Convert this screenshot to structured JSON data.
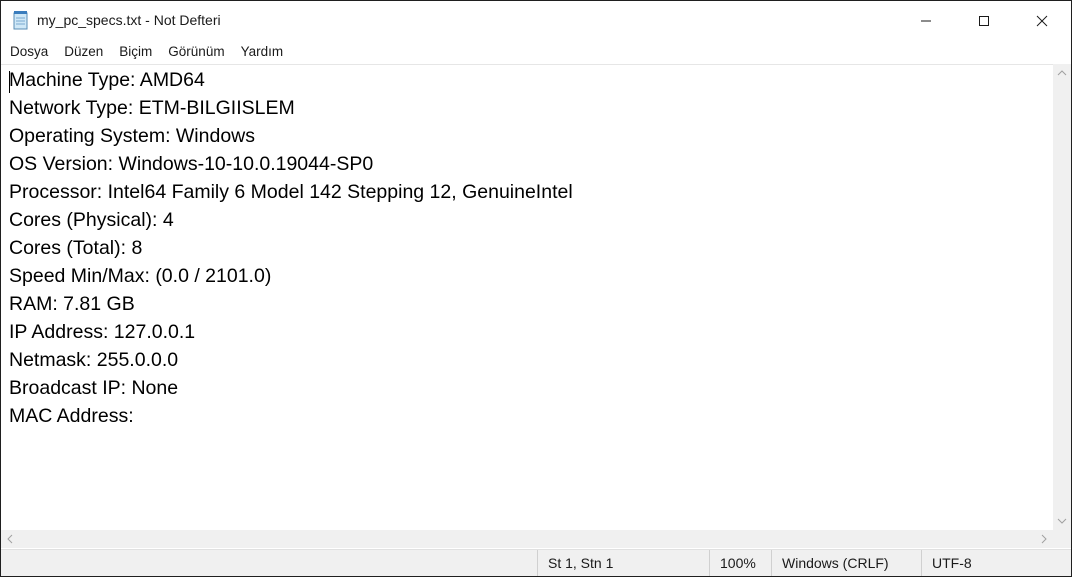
{
  "window": {
    "title": "my_pc_specs.txt - Not Defteri",
    "icons": {
      "app": "notepad-icon",
      "minimize": "minimize-icon",
      "maximize": "maximize-icon",
      "close": "close-icon"
    }
  },
  "menu": {
    "items": [
      "Dosya",
      "Düzen",
      "Biçim",
      "Görünüm",
      "Yardım"
    ]
  },
  "editor": {
    "lines": [
      "Machine Type: AMD64",
      "Network Type: ETM-BILGIISLEM",
      "Operating System: Windows",
      "OS Version: Windows-10-10.0.19044-SP0",
      "Processor: Intel64 Family 6 Model 142 Stepping 12, GenuineIntel",
      "Cores (Physical): 4",
      "Cores (Total): 8",
      "Speed Min/Max: (0.0 / 2101.0)",
      "RAM: 7.81 GB",
      "IP Address: 127.0.0.1",
      "Netmask: 255.0.0.0",
      "Broadcast IP: None",
      "MAC Address:"
    ]
  },
  "statusbar": {
    "position": "St 1, Stn 1",
    "zoom": "100%",
    "line_ending": "Windows (CRLF)",
    "encoding": "UTF-8"
  },
  "colors": {
    "titlebar_bg": "#ffffff",
    "statusbar_bg": "#f0f0f0",
    "text": "#000000"
  }
}
